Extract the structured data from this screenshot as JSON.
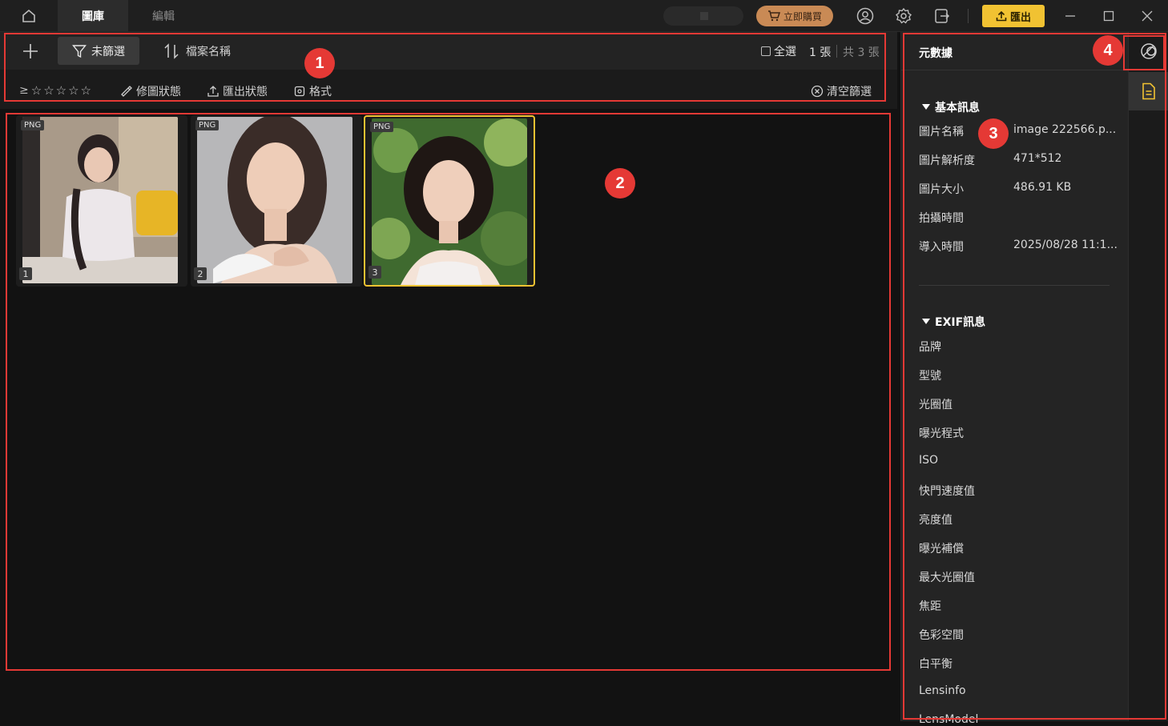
{
  "titlebar": {
    "tabs": [
      {
        "label": "圖庫",
        "active": true
      },
      {
        "label": "編輯",
        "active": false
      }
    ],
    "buy_label": "立即購買",
    "export_label": "匯出"
  },
  "toolbar": {
    "filter_label": "未篩選",
    "sort_label": "檔案名稱",
    "select_all_label": "全選",
    "selected_count": "1 張",
    "total_count": "共 3 張"
  },
  "subbar": {
    "rating_prefix": "≥",
    "rating_stars": 5,
    "edit_status": "修圖狀態",
    "export_status": "匯出狀態",
    "format": "格式",
    "clear": "清空篩選"
  },
  "grid": {
    "items": [
      {
        "type": "PNG",
        "index": "1",
        "selected": false
      },
      {
        "type": "PNG",
        "index": "2",
        "selected": false
      },
      {
        "type": "PNG",
        "index": "3",
        "selected": true
      }
    ]
  },
  "panel": {
    "title": "元數據",
    "basic": {
      "heading": "基本訊息",
      "rows": [
        {
          "label": "圖片名稱",
          "value": "image 222566.p..."
        },
        {
          "label": "圖片解析度",
          "value": "471*512"
        },
        {
          "label": "圖片大小",
          "value": "486.91 KB"
        },
        {
          "label": "拍攝時間",
          "value": ""
        },
        {
          "label": "導入時間",
          "value": "2025/08/28 11:1..."
        }
      ]
    },
    "exif": {
      "heading": "EXIF訊息",
      "rows": [
        "品牌",
        "型號",
        "光圈值",
        "曝光程式",
        "ISO",
        "快門速度值",
        "亮度值",
        "曝光補償",
        "最大光圈值",
        "焦距",
        "色彩空間",
        "白平衡",
        "Lensinfo",
        "LensModel"
      ]
    }
  },
  "annotations": [
    "1",
    "2",
    "3",
    "4"
  ],
  "colors": {
    "accent": "#f1c232",
    "buy": "#c98a55",
    "annotation": "#e53935"
  }
}
